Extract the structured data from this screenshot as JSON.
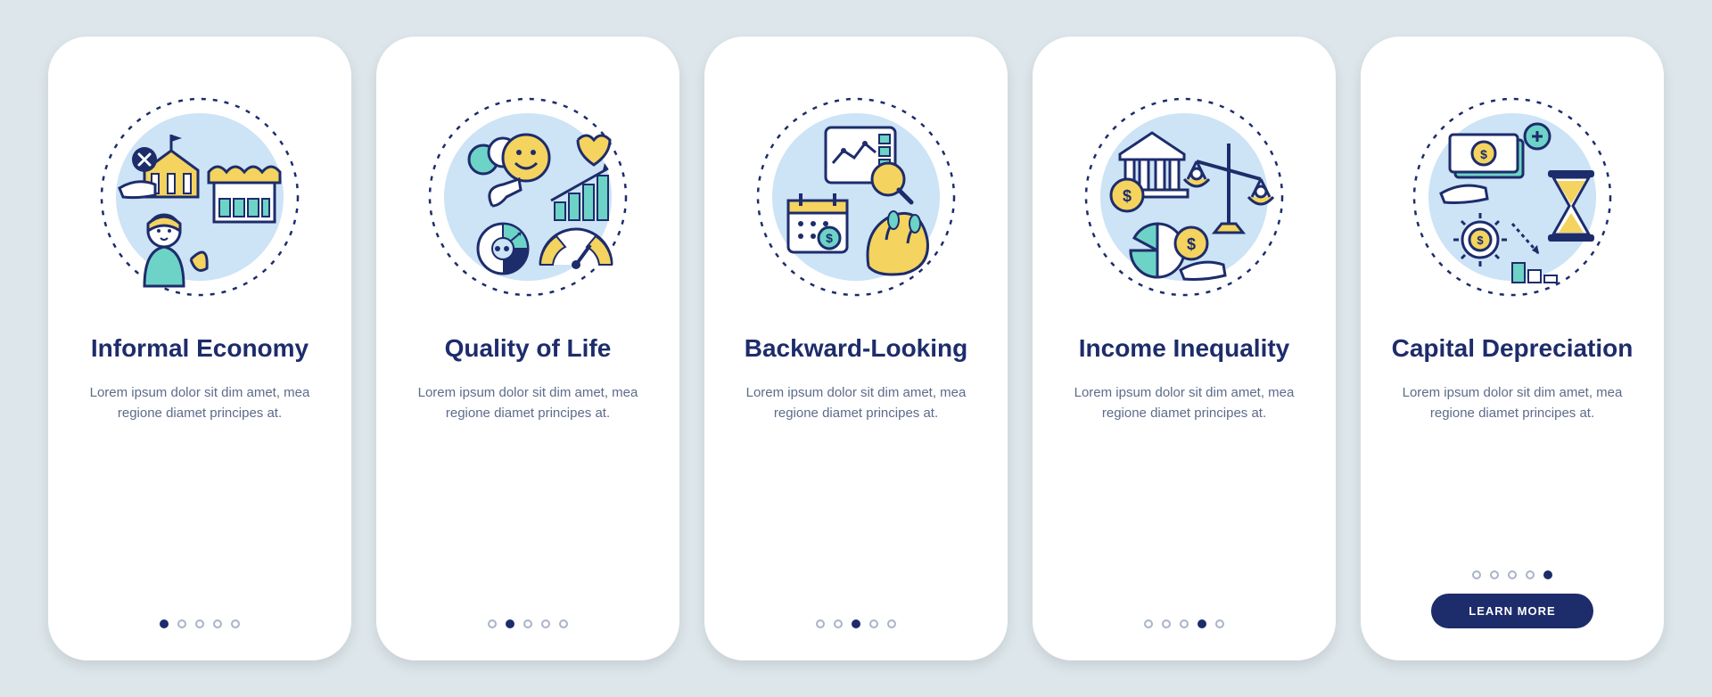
{
  "colors": {
    "bg": "#dde6eb",
    "card": "#ffffff",
    "primary": "#1d2c6b",
    "accent_yellow": "#f4d35e",
    "accent_teal": "#6dd3c7",
    "light_blue": "#cde3f6",
    "text_muted": "#5d6b8a"
  },
  "cards": [
    {
      "id": "informal-economy",
      "title": "Informal Economy",
      "desc": "Lorem ipsum dolor sit dim amet, mea regione diamet principes at.",
      "icon": "informal-economy-icon",
      "active_dot": 0
    },
    {
      "id": "quality-of-life",
      "title": "Quality of Life",
      "desc": "Lorem ipsum dolor sit dim amet, mea regione diamet principes at.",
      "icon": "quality-of-life-icon",
      "active_dot": 1
    },
    {
      "id": "backward-looking",
      "title": "Backward-Looking",
      "desc": "Lorem ipsum dolor sit dim amet, mea regione diamet principes at.",
      "icon": "backward-looking-icon",
      "active_dot": 2
    },
    {
      "id": "income-inequality",
      "title": "Income Inequality",
      "desc": "Lorem ipsum dolor sit dim amet, mea regione diamet principes at.",
      "icon": "income-inequality-icon",
      "active_dot": 3
    },
    {
      "id": "capital-depreciation",
      "title": "Capital Depreciation",
      "desc": "Lorem ipsum dolor sit dim amet, mea regione diamet principes at.",
      "icon": "capital-depreciation-icon",
      "active_dot": 4,
      "button_label": "LEARN MORE"
    }
  ],
  "dot_count": 5
}
